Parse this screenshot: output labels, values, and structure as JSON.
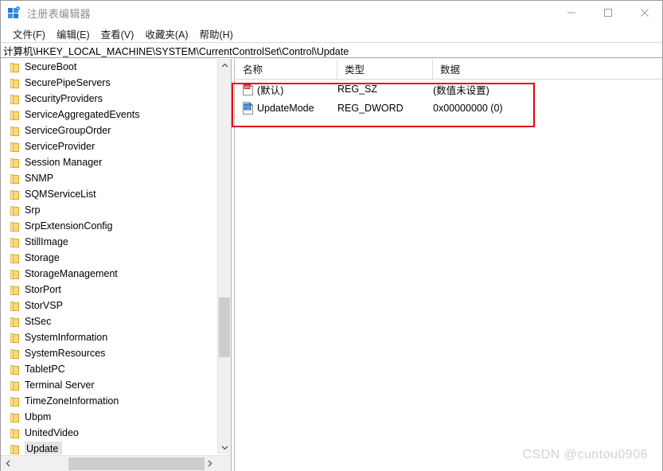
{
  "window": {
    "title": "注册表编辑器",
    "app_icon": "registry-editor-icon",
    "controls": {
      "minimize": "最小化",
      "maximize": "最大化",
      "close": "关闭"
    }
  },
  "menubar": {
    "items": [
      {
        "label": "文件(F)"
      },
      {
        "label": "编辑(E)"
      },
      {
        "label": "查看(V)"
      },
      {
        "label": "收藏夹(A)"
      },
      {
        "label": "帮助(H)"
      }
    ]
  },
  "address": {
    "path": "计算机\\HKEY_LOCAL_MACHINE\\SYSTEM\\CurrentControlSet\\Control\\Update"
  },
  "tree": {
    "items": [
      {
        "label": "SecureBoot",
        "selected": false
      },
      {
        "label": "SecurePipeServers",
        "selected": false
      },
      {
        "label": "SecurityProviders",
        "selected": false
      },
      {
        "label": "ServiceAggregatedEvents",
        "selected": false
      },
      {
        "label": "ServiceGroupOrder",
        "selected": false
      },
      {
        "label": "ServiceProvider",
        "selected": false
      },
      {
        "label": "Session Manager",
        "selected": false
      },
      {
        "label": "SNMP",
        "selected": false
      },
      {
        "label": "SQMServiceList",
        "selected": false
      },
      {
        "label": "Srp",
        "selected": false
      },
      {
        "label": "SrpExtensionConfig",
        "selected": false
      },
      {
        "label": "StillImage",
        "selected": false
      },
      {
        "label": "Storage",
        "selected": false
      },
      {
        "label": "StorageManagement",
        "selected": false
      },
      {
        "label": "StorPort",
        "selected": false
      },
      {
        "label": "StorVSP",
        "selected": false
      },
      {
        "label": "StSec",
        "selected": false
      },
      {
        "label": "SystemInformation",
        "selected": false
      },
      {
        "label": "SystemResources",
        "selected": false
      },
      {
        "label": "TabletPC",
        "selected": false
      },
      {
        "label": "Terminal Server",
        "selected": false
      },
      {
        "label": "TimeZoneInformation",
        "selected": false
      },
      {
        "label": "Ubpm",
        "selected": false
      },
      {
        "label": "UnitedVideo",
        "selected": false
      },
      {
        "label": "Update",
        "selected": true
      }
    ]
  },
  "values": {
    "columns": [
      {
        "label": "名称"
      },
      {
        "label": "类型"
      },
      {
        "label": "数据"
      }
    ],
    "rows": [
      {
        "icon": "string-value-icon",
        "name": "(默认)",
        "type": "REG_SZ",
        "data": "(数值未设置)"
      },
      {
        "icon": "dword-value-icon",
        "name": "UpdateMode",
        "type": "REG_DWORD",
        "data": "0x00000000 (0)"
      }
    ]
  },
  "annotation": {
    "color": "#e60012"
  },
  "watermark": {
    "text": "CSDN @cuntou0906"
  }
}
